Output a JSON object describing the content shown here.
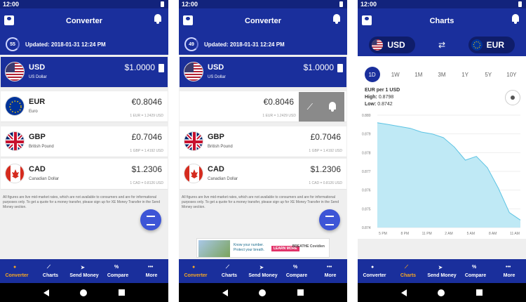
{
  "status": {
    "time": "12:00"
  },
  "screen1": {
    "title": "Converter",
    "update_count": "55",
    "updated_text": "Updated: 2018-01-31 12:24 PM",
    "rows": [
      {
        "code": "USD",
        "name": "US Dollar",
        "rate": "$1.0000",
        "conv": ""
      },
      {
        "code": "EUR",
        "name": "Euro",
        "rate": "€0.8046",
        "conv": "1 EUR = 1.2429 USD"
      },
      {
        "code": "GBP",
        "name": "British Pound",
        "rate": "£0.7046",
        "conv": "1 GBP = 1.4192 USD"
      },
      {
        "code": "CAD",
        "name": "Canadian Dollar",
        "rate": "$1.2306",
        "conv": "1 CAD = 0.8126 USD"
      }
    ],
    "disclaimer": "All figures are live mid-market rates, which are not available to consumers and are for informational purposes only. To get a quote for a money transfer, please sign up for XE Money Transfer in the Send Money section."
  },
  "screen2": {
    "title": "Converter",
    "update_count": "49",
    "updated_text": "Updated: 2018-01-31 12:24 PM",
    "ad": {
      "text": "Know your number. Protect your breath.",
      "button": "LEARN MORE",
      "brand": "BREATHE Covidien"
    }
  },
  "screen3": {
    "title": "Charts",
    "from": "USD",
    "to": "EUR",
    "ranges": [
      "1D",
      "1W",
      "1M",
      "3M",
      "1Y",
      "5Y",
      "10Y"
    ],
    "active_range": "1D",
    "pair_label": "EUR per 1 USD",
    "high_label": "High:",
    "high_value": "0.8798",
    "low_label": "Low:",
    "low_value": "0.8742"
  },
  "tabs": [
    {
      "label": "Converter",
      "icon": "coins-icon"
    },
    {
      "label": "Charts",
      "icon": "chart-icon"
    },
    {
      "label": "Send Money",
      "icon": "send-icon"
    },
    {
      "label": "Compare",
      "icon": "percent-icon"
    },
    {
      "label": "More",
      "icon": "more-icon"
    }
  ],
  "chart_data": {
    "type": "area",
    "title": "",
    "xlabel": "",
    "ylabel": "",
    "x": [
      "5 PM",
      "8 PM",
      "11 PM",
      "2 AM",
      "5 AM",
      "8 AM",
      "11 AM"
    ],
    "ylim": [
      0.874,
      0.88
    ],
    "yticks": [
      0.88,
      0.879,
      0.878,
      0.877,
      0.876,
      0.875,
      0.874
    ],
    "ytick_labels": [
      "0.880",
      "0.879",
      "0.878",
      "0.877",
      "0.876",
      "0.875",
      "0.874"
    ],
    "series": [
      {
        "values": [
          0.8796,
          0.8795,
          0.8794,
          0.8793,
          0.8791,
          0.879,
          0.8788,
          0.8783,
          0.8776,
          0.8778,
          0.8772,
          0.8761,
          0.8748,
          0.8744
        ]
      }
    ],
    "grid": true,
    "legend": "none"
  }
}
